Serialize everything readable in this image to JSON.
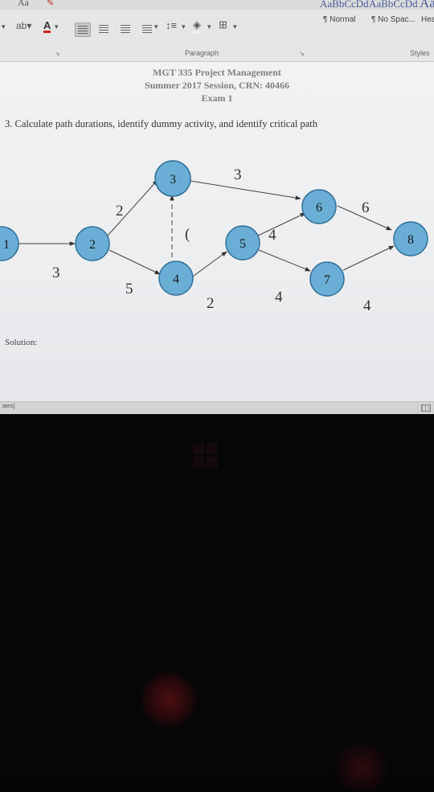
{
  "ribbon": {
    "font_size_label": "Aa",
    "styles": [
      {
        "sample": "AaBbCcDd",
        "name": "¶ Normal"
      },
      {
        "sample": "AaBbCcDd",
        "name": "¶ No Spac..."
      },
      {
        "sample": "Aa",
        "name": "Hea"
      }
    ],
    "paragraph_group_label": "Paragraph",
    "styles_group_label": "Styles"
  },
  "document": {
    "course_title": "MGT 335 Project Management",
    "session": "Summer 2017 Session, CRN: 40466",
    "exam": "Exam 1",
    "question": "3.  Calculate path durations, identify dummy activity, and identify critical path",
    "solution_label": "Solution:"
  },
  "diagram": {
    "nodes": [
      {
        "id": "1",
        "label": "1"
      },
      {
        "id": "2",
        "label": "2"
      },
      {
        "id": "3",
        "label": "3"
      },
      {
        "id": "4",
        "label": "4"
      },
      {
        "id": "5",
        "label": "5"
      },
      {
        "id": "6",
        "label": "6"
      },
      {
        "id": "7",
        "label": "7"
      },
      {
        "id": "8",
        "label": "8"
      }
    ],
    "edges": [
      {
        "from": "1",
        "to": "2",
        "label": "3"
      },
      {
        "from": "2",
        "to": "3",
        "label": "2"
      },
      {
        "from": "2",
        "to": "4",
        "label": "5"
      },
      {
        "from": "4",
        "to": "3",
        "label": "(",
        "dashed": true
      },
      {
        "from": "3",
        "to": "6",
        "label": "3"
      },
      {
        "from": "4",
        "to": "5",
        "label": "2"
      },
      {
        "from": "5",
        "to": "6",
        "label": "4"
      },
      {
        "from": "5",
        "to": "7",
        "label": "4"
      },
      {
        "from": "6",
        "to": "8",
        "label": "6"
      },
      {
        "from": "7",
        "to": "8",
        "label": "4"
      }
    ],
    "node_fill": "#6aaed6",
    "node_stroke": "#2f6f97"
  },
  "statusbar": {
    "left_text": "ates]"
  }
}
